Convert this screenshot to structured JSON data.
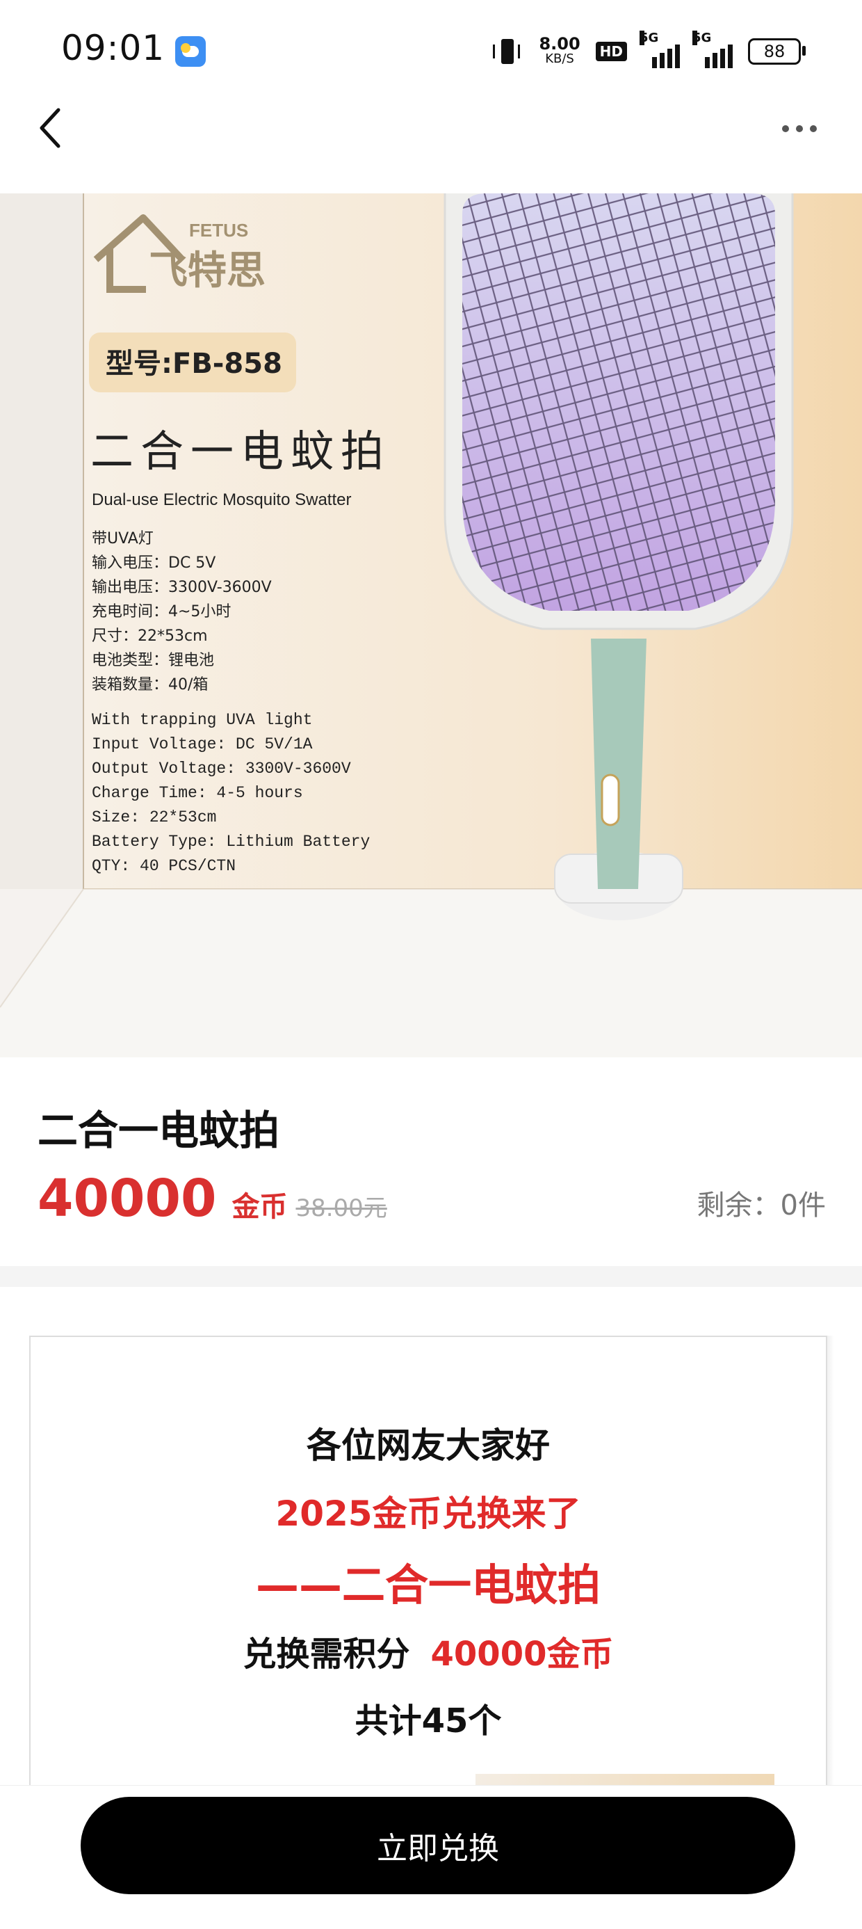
{
  "status_bar": {
    "time": "09:01",
    "net_speed": "8.00",
    "net_speed_unit": "KB/S",
    "hd_badge": "HD",
    "signal1_label": "5G",
    "signal2_label": "5G",
    "battery": "88"
  },
  "nav": {
    "back_icon": "chevron-left-icon",
    "more_icon": "more-dots-icon"
  },
  "hero_image": {
    "brand_en": "FETUS",
    "brand_cn": "飞特思",
    "model": "型号:FB-858",
    "headline_cn": "二合一电蚊拍",
    "headline_en": "Dual-use Electric Mosquito Swatter",
    "specs_cn": [
      "带UVA灯",
      "输入电压：DC 5V",
      "输出电压：3300V-3600V",
      "充电时间：4~5小时",
      "尺寸：22*53cm",
      "电池类型：锂电池",
      "装箱数量：40/箱"
    ],
    "specs_en": [
      "With trapping UVA light",
      "Input Voltage: DC 5V/1A",
      "Output Voltage: 3300V-3600V",
      "Charge Time: 4-5 hours",
      "Size: 22*53cm",
      "Battery Type: Lithium Battery",
      "QTY: 40 PCS/CTN"
    ]
  },
  "product": {
    "title": "二合一电蚊拍",
    "price": "40000",
    "price_unit": "金币",
    "original_price": "38.00元",
    "stock_label": "剩余：",
    "stock_value": "0件"
  },
  "detail": {
    "line1": "各位网友大家好",
    "line2": "2025金币兑换来了",
    "line3": "——二合一电蚊拍",
    "line4_text": "兑换需积分",
    "line4_value": "40000金币",
    "line5": "共计45个"
  },
  "bottom": {
    "exchange_button": "立即兑换"
  },
  "colors": {
    "price_red": "#d9302f",
    "button_bg": "#000000"
  }
}
